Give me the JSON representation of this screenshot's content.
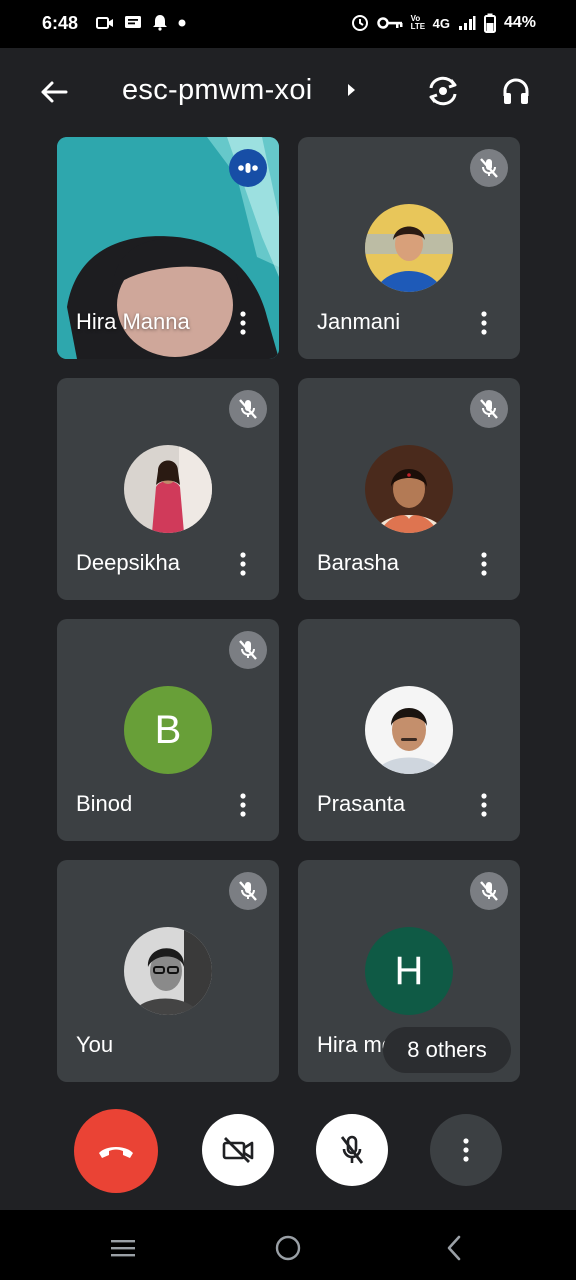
{
  "status_bar": {
    "time": "6:48",
    "network": "4G",
    "volte": "Vo LTE",
    "battery": "44%"
  },
  "header": {
    "meeting_code": "esc-pmwm-xoi"
  },
  "participants": [
    {
      "name": "Hira Manna",
      "state": "speaking",
      "video": true
    },
    {
      "name": "Janmani",
      "state": "muted",
      "avatar_colors": [
        "#f4c542",
        "#1e5ab8"
      ]
    },
    {
      "name": "Deepsikha",
      "state": "muted",
      "avatar_colors": [
        "#e9a7b8",
        "#d03a5a"
      ]
    },
    {
      "name": "Barasha",
      "state": "muted",
      "avatar_colors": [
        "#5a2e1a",
        "#d8a36a"
      ]
    },
    {
      "name": "Binod",
      "state": "muted",
      "initial": "B",
      "avatar_color": "#689f38"
    },
    {
      "name": "Prasanta",
      "state": "unmuted",
      "avatar_colors": [
        "#ffffff",
        "#c98b6b"
      ]
    },
    {
      "name": "You",
      "state": "muted",
      "avatar_colors": [
        "#dcdcdc",
        "#333333"
      ]
    },
    {
      "name": "Hira moni",
      "state": "muted",
      "initial": "H",
      "avatar_color": "#0f5a45"
    }
  ],
  "others_chip": "8 others",
  "colors": {
    "background": "#202124",
    "tile": "#3c4043",
    "end_call": "#ea4335",
    "speaking": "#174ea6"
  }
}
